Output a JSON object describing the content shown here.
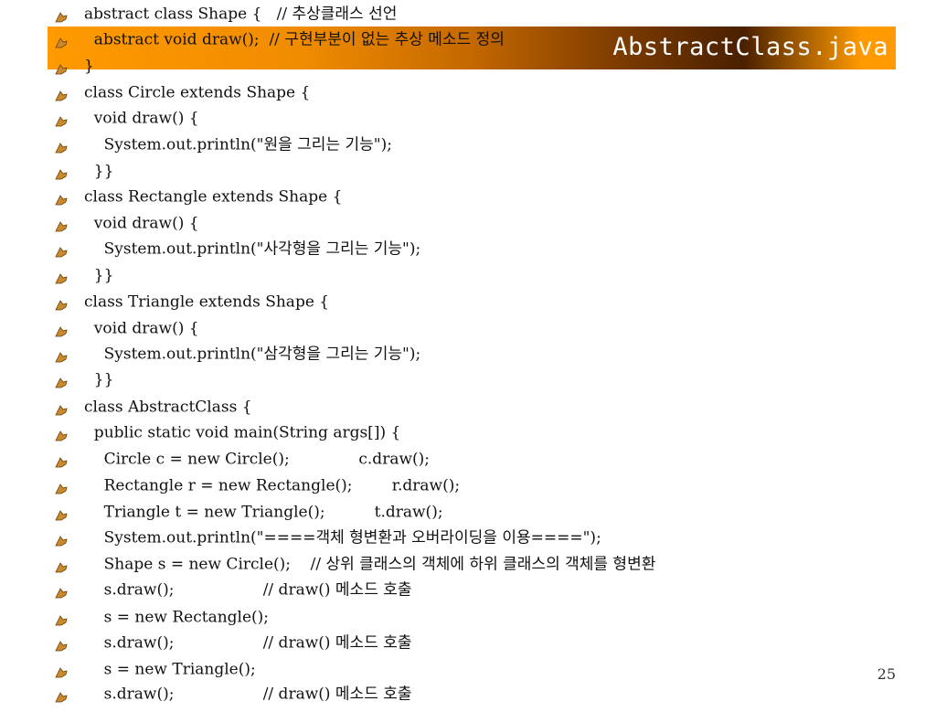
{
  "slide": {
    "title": "AbstractClass.java",
    "page_number": "25",
    "lines": [
      "abstract class Shape {   // 추상클래스 선언",
      "  abstract void draw();  // 구현부분이 없는 추상 메소드 정의",
      "}",
      "class Circle extends Shape {",
      "  void draw() {",
      "    System.out.println(\"원을 그리는 기능\");",
      "  }}",
      "class Rectangle extends Shape {",
      "  void draw() {",
      "    System.out.println(\"사각형을 그리는 기능\");",
      "  }}",
      "class Triangle extends Shape {",
      "  void draw() {",
      "    System.out.println(\"삼각형을 그리는 기능\");",
      "  }}",
      "class AbstractClass {",
      "  public static void main(String args[]) {",
      "    Circle c = new Circle();              c.draw();",
      "    Rectangle r = new Rectangle();        r.draw();",
      "    Triangle t = new Triangle();          t.draw();",
      "    System.out.println(\"====객체 형변환과 오버라이딩을 이용====\");",
      "    Shape s = new Circle();    // 상위 클래스의 객체에 하위 클래스의 객체를 형변환",
      "    s.draw();                  // draw() 메소드 호출",
      "    s = new Rectangle();",
      "    s.draw();                  // draw() 메소드 호출",
      "    s = new Triangle();",
      "    s.draw();                  // draw() 메소드 호출"
    ]
  }
}
